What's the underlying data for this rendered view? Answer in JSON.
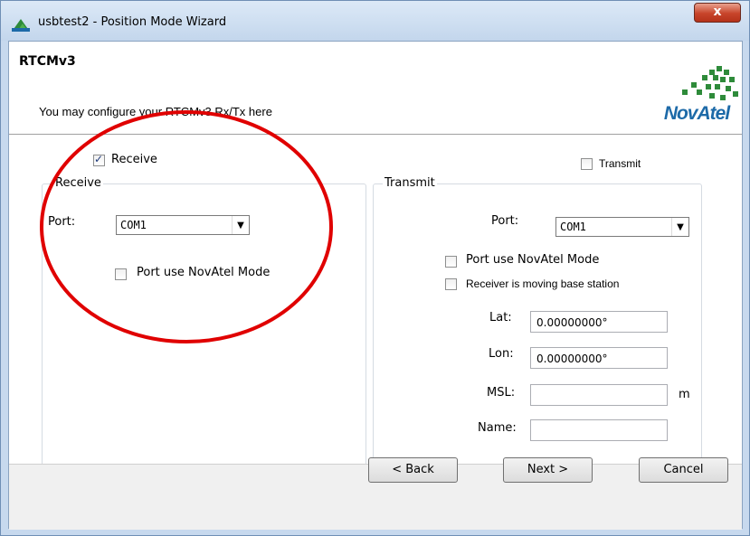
{
  "window": {
    "title": "usbtest2 - Position Mode Wizard",
    "close_label": "x"
  },
  "header": {
    "title": "RTCMv3",
    "subtitle": "You may configure your RTCMv3 Rx/Tx here",
    "logo_text": "NovAtel"
  },
  "top_checks": {
    "receive": {
      "label": "Receive",
      "checked": true
    },
    "transmit": {
      "label": "Transmit",
      "checked": false
    }
  },
  "receive_group": {
    "legend": "Receive",
    "port_label": "Port:",
    "port_value": "COM1",
    "novatel_mode_label": "Port use NovAtel Mode",
    "novatel_mode_checked": false
  },
  "transmit_group": {
    "legend": "Transmit",
    "port_label": "Port:",
    "port_value": "COM1",
    "novatel_mode_label": "Port use NovAtel Mode",
    "novatel_mode_checked": false,
    "moving_base_label": "Receiver is moving base station",
    "moving_base_checked": false,
    "lat_label": "Lat:",
    "lat_value": "0.00000000°",
    "lon_label": "Lon:",
    "lon_value": "0.00000000°",
    "msl_label": "MSL:",
    "msl_value": "",
    "msl_unit": "m",
    "name_label": "Name:",
    "name_value": ""
  },
  "buttons": {
    "back": "< Back",
    "next": "Next >",
    "cancel": "Cancel"
  },
  "colors": {
    "annotation_circle": "#e00000",
    "logo_green": "#2e8b3a",
    "logo_blue": "#1d6aa8"
  }
}
